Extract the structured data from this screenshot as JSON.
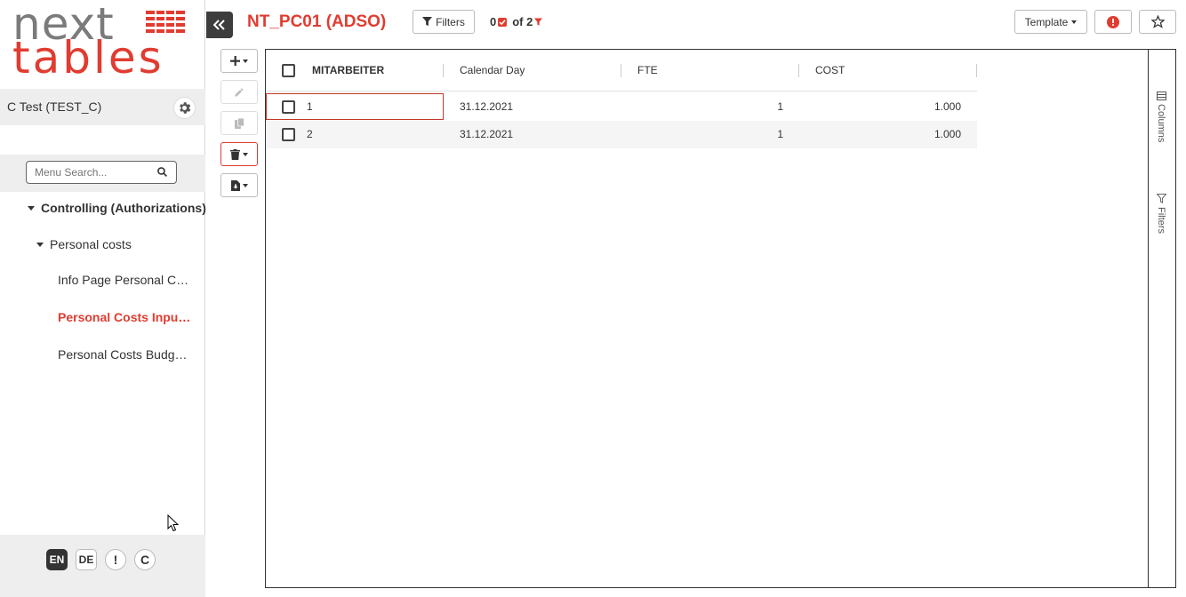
{
  "logo": {
    "line1": "next",
    "line2": "tables"
  },
  "user": {
    "name": "C Test (TEST_C)"
  },
  "menu_search": {
    "placeholder": "Menu Search..."
  },
  "tree": {
    "group": "Controlling (Authorizations)",
    "subgroup": "Personal costs",
    "items": [
      {
        "label": "Info Page Personal Co..."
      },
      {
        "label": "Personal Costs Input ..."
      },
      {
        "label": "Personal Costs Budget..."
      }
    ]
  },
  "footer": {
    "en": "EN",
    "de": "DE",
    "alert": "!",
    "c": "C"
  },
  "header": {
    "title": "NT_PC01 (ADSO)",
    "filters_label": "Filters",
    "count_selected": "0",
    "count_total": "of 2",
    "template_label": "Template"
  },
  "table": {
    "columns": [
      "MITARBEITER",
      "Calendar Day",
      "FTE",
      "COST"
    ],
    "rows": [
      {
        "mitarbeiter": "1",
        "calendar_day": "31.12.2021",
        "fte": "1",
        "cost": "1.000"
      },
      {
        "mitarbeiter": "2",
        "calendar_day": "31.12.2021",
        "fte": "1",
        "cost": "1.000"
      }
    ]
  },
  "side_panel": {
    "columns": "Columns",
    "filters": "Filters"
  },
  "colors": {
    "accent": "#e03c31",
    "dark": "#3d3d3d"
  }
}
